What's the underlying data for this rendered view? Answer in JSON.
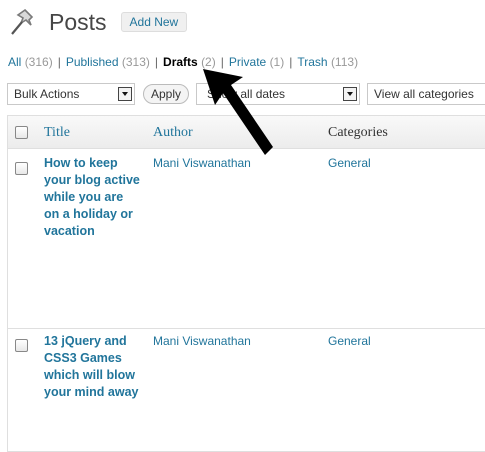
{
  "header": {
    "title": "Posts",
    "add_new_label": "Add New",
    "icon": "pushpin-icon"
  },
  "filters": {
    "all": {
      "label": "All",
      "count": "(316)"
    },
    "published": {
      "label": "Published",
      "count": "(313)"
    },
    "drafts": {
      "label": "Drafts",
      "count": "(2)"
    },
    "private": {
      "label": "Private",
      "count": "(1)"
    },
    "trash": {
      "label": "Trash",
      "count": "(113)"
    },
    "separator": "|"
  },
  "toolbar": {
    "bulk_actions": "Bulk Actions",
    "apply_label": "Apply",
    "dates": "Show all dates",
    "categories": "View all categories"
  },
  "table": {
    "columns": [
      "Title",
      "Author",
      "Categories"
    ],
    "rows": [
      {
        "title": "How to keep your blog active while you are on a holiday or vacation",
        "author": "Mani Viswanathan",
        "category": "General"
      },
      {
        "title": "13 jQuery and CSS3 Games which will blow your mind away",
        "author": "Mani Viswanathan",
        "category": "General"
      }
    ]
  },
  "colors": {
    "link": "#21759b",
    "title_text": "#464646",
    "border": "#dfdfdf"
  }
}
